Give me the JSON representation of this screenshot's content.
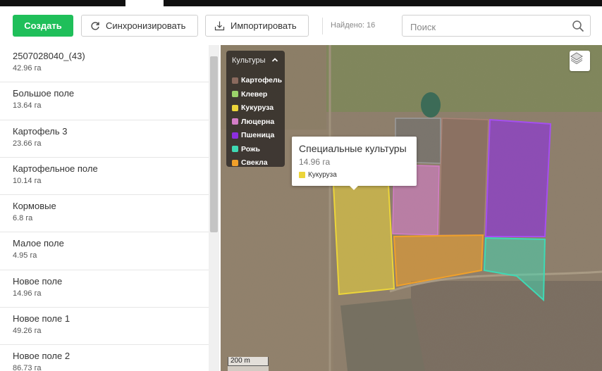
{
  "toolbar": {
    "create_label": "Создать",
    "sync_label": "Синхронизировать",
    "import_label": "Импортировать",
    "found_text": "Найдено: 16",
    "search_placeholder": "Поиск"
  },
  "fields": [
    {
      "name": "2507028040_(43)",
      "area": "42.96 га"
    },
    {
      "name": "Большое поле",
      "area": "13.64 га"
    },
    {
      "name": "Картофель 3",
      "area": "23.66 га"
    },
    {
      "name": "Картофельное поле",
      "area": "10.14 га"
    },
    {
      "name": "Кормовые",
      "area": "6.8 га"
    },
    {
      "name": "Малое поле",
      "area": "4.95 га"
    },
    {
      "name": "Новое поле",
      "area": "14.96 га"
    },
    {
      "name": "Новое поле 1",
      "area": "49.26 га"
    },
    {
      "name": "Новое поле 2",
      "area": "86.73 га"
    }
  ],
  "legend": {
    "title": "Культуры",
    "items": [
      {
        "label": "Картофель",
        "color": "#8a6a5e"
      },
      {
        "label": "Клевер",
        "color": "#9bd36a"
      },
      {
        "label": "Кукуруза",
        "color": "#ecd53a"
      },
      {
        "label": "Люцерна",
        "color": "#d47ec7"
      },
      {
        "label": "Пшеница",
        "color": "#8d2ee0"
      },
      {
        "label": "Рожь",
        "color": "#3fd9b4"
      },
      {
        "label": "Свекла",
        "color": "#f0a02a"
      }
    ]
  },
  "popup": {
    "title": "Специальные культуры",
    "area": "14.96 га",
    "crop": "Кукуруза"
  },
  "map": {
    "scale_label": "200 m"
  },
  "icons": {
    "sync": "sync-icon",
    "import": "download-icon",
    "search": "search-icon",
    "layers": "layers-icon",
    "collapse": "chevron-up-icon"
  }
}
